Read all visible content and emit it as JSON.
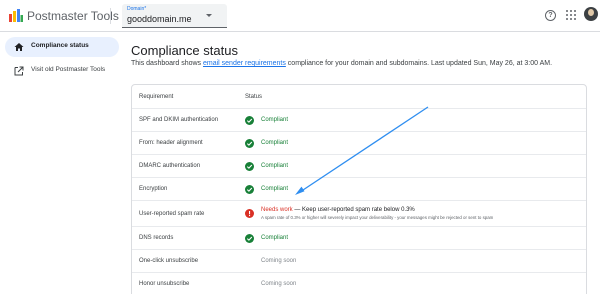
{
  "header": {
    "app_title": "Postmaster Tools",
    "domain_label": "Domain*",
    "domain_value": "gooddomain.me",
    "help_glyph": "?",
    "icons": [
      "postmaster-logo-icon",
      "help-icon",
      "apps-grid-icon",
      "avatar"
    ]
  },
  "sidebar": {
    "items": [
      {
        "label": "Compliance status",
        "icon": "home-icon",
        "active": true
      },
      {
        "label": "Visit old Postmaster Tools",
        "icon": "open-in-new-icon",
        "active": false
      }
    ]
  },
  "main": {
    "title": "Compliance status",
    "description_before": "This dashboard shows ",
    "description_link": "email sender requirements",
    "description_after": " compliance for your domain and subdomains. Last updated Sun, May 26, at 3:00 AM."
  },
  "table": {
    "headers": {
      "requirement": "Requirement",
      "status": "Status"
    },
    "rows": [
      {
        "requirement": "SPF and DKIM authentication",
        "status": "Compliant",
        "state": "ok"
      },
      {
        "requirement": "From: header alignment",
        "status": "Compliant",
        "state": "ok"
      },
      {
        "requirement": "DMARC authentication",
        "status": "Compliant",
        "state": "ok"
      },
      {
        "requirement": "Encryption",
        "status": "Compliant",
        "state": "ok"
      },
      {
        "requirement": "User-reported spam rate",
        "status": "Needs work",
        "status_tail": " — Keep user-reported spam rate below 0.3%",
        "detail": "A spam rate of 0.3% or higher will severely impact your deliverability - your messages might be rejected or sent to spam",
        "state": "warn"
      },
      {
        "requirement": "DNS records",
        "status": "Compliant",
        "state": "ok"
      },
      {
        "requirement": "One-click unsubscribe",
        "status": "Coming soon",
        "state": "soon"
      },
      {
        "requirement": "Honor unsubscribe",
        "status": "Coming soon",
        "state": "soon"
      }
    ]
  },
  "colors": {
    "accent": "#1a73e8",
    "compliant": "#188038",
    "needs_work": "#d93025",
    "annotation_arrow": "#2f8ef0"
  }
}
